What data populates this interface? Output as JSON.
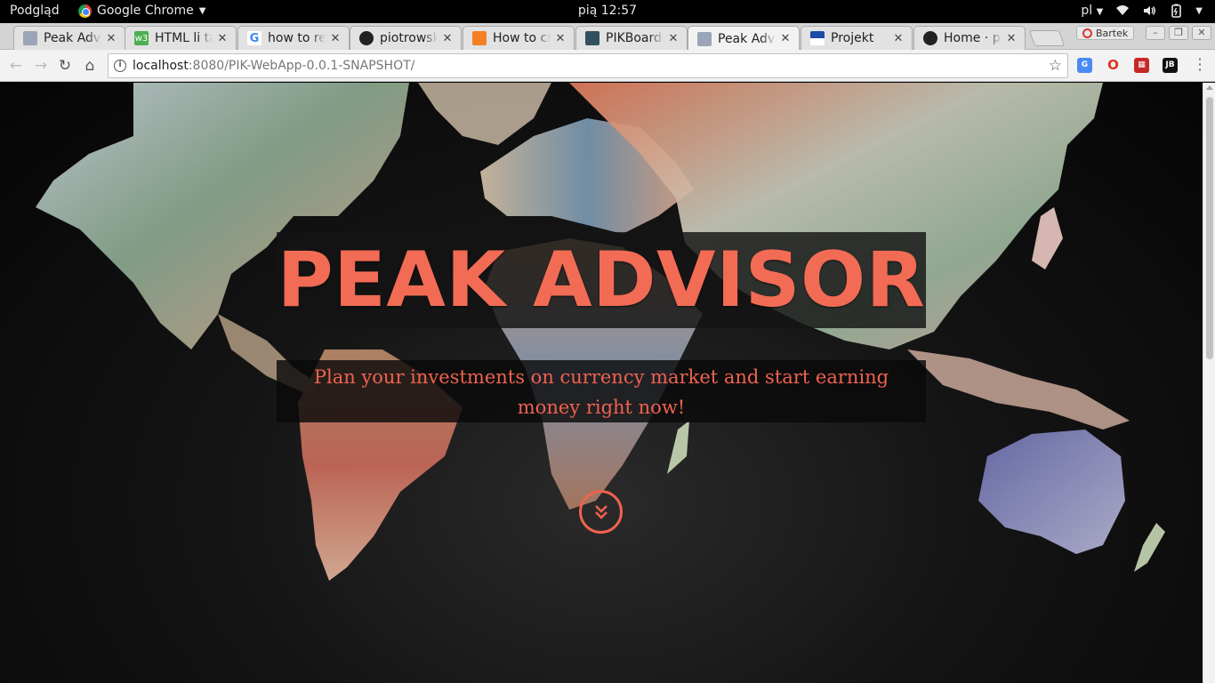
{
  "system_bar": {
    "activities": "Podgląd",
    "app_name": "Google Chrome",
    "clock": "pią 12:57",
    "keyboard_layout": "pl"
  },
  "tabs": [
    {
      "title": "Peak Advisor",
      "favicon": "page-icon",
      "active": false
    },
    {
      "title": "HTML li tag",
      "favicon": "w3schools-icon",
      "active": false
    },
    {
      "title": "how to re",
      "favicon": "google-icon",
      "active": false
    },
    {
      "title": "piotrowsk",
      "favicon": "github-icon",
      "active": false
    },
    {
      "title": "How to cr",
      "favicon": "stackoverflow-icon",
      "active": false
    },
    {
      "title": "PIKBoard",
      "favicon": "jenkins-icon",
      "active": false
    },
    {
      "title": "Peak Advisor",
      "favicon": "page-icon",
      "active": true
    },
    {
      "title": "Projekt",
      "favicon": "flag-icon",
      "active": false
    },
    {
      "title": "Home · pi",
      "favicon": "github-icon",
      "active": false
    }
  ],
  "profile_name": "Bartek",
  "address_bar": {
    "host": "localhost",
    "path": ":8080/PIK-WebApp-0.0.1-SNAPSHOT/"
  },
  "hero": {
    "title": "PEAK ADVISOR",
    "subtitle": "Plan your investments on currency market and start earning money right now!"
  },
  "colors": {
    "accent": "#f26b55",
    "background": "#000000"
  }
}
